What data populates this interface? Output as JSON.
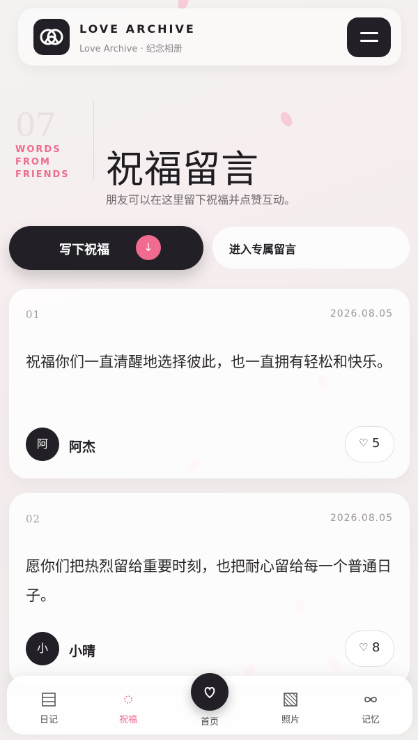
{
  "header": {
    "brand_title": "LOVE ARCHIVE",
    "brand_subtitle": "Love Archive · 纪念相册"
  },
  "section": {
    "number": "07",
    "tag_lines": [
      "WORDS",
      "FROM",
      "FRIENDS"
    ],
    "title": "祝福留言",
    "subtitle": "朋友可以在这里留下祝福并点赞互动。"
  },
  "actions": {
    "write_label": "写下祝福",
    "write_arrow": "↓",
    "exclusive_label": "进入专属留言"
  },
  "messages": [
    {
      "index": "01",
      "date": "2026.08.05",
      "text": "祝福你们一直清醒地选择彼此，也一直拥有轻松和快乐。",
      "avatar": "阿",
      "name": "阿杰",
      "likes": "5"
    },
    {
      "index": "02",
      "date": "2026.08.05",
      "text": "愿你们把热烈留给重要时刻，也把耐心留给每一个普通日子。",
      "avatar": "小",
      "name": "小晴",
      "likes": "8"
    }
  ],
  "tabbar": {
    "items": [
      {
        "label": "日记",
        "icon": "diary-icon"
      },
      {
        "label": "祝福",
        "icon": "blessing-icon",
        "active": true
      },
      {
        "label": "首页",
        "icon": "heart-icon"
      },
      {
        "label": "照片",
        "icon": "photo-icon"
      },
      {
        "label": "记忆",
        "icon": "infinity-icon"
      }
    ]
  },
  "colors": {
    "accent": "#ef6b8e",
    "dark": "#222026"
  }
}
